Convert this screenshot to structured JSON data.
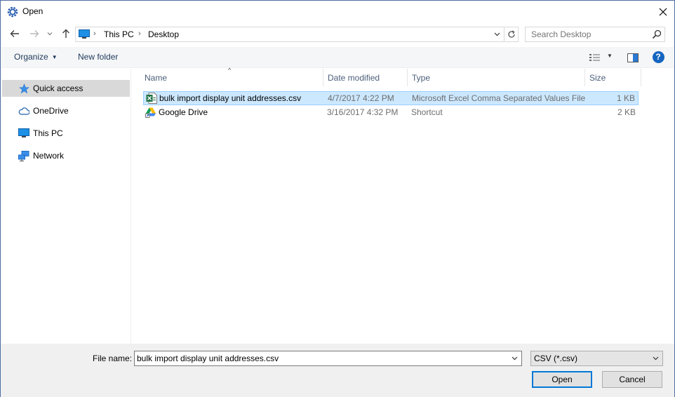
{
  "window": {
    "title": "Open",
    "icon": "app-gear-icon",
    "close_icon": "close-icon"
  },
  "nav_buttons": {
    "back_icon": "back-arrow-icon",
    "forward_icon": "forward-arrow-icon",
    "recent_icon": "chevron-down-icon",
    "up_icon": "up-arrow-icon"
  },
  "address_bar": {
    "location_icon": "this-pc-icon",
    "breadcrumbs": [
      {
        "label": "This PC"
      },
      {
        "label": "Desktop"
      }
    ],
    "separator": "›",
    "refresh_icon": "refresh-icon"
  },
  "search": {
    "placeholder": "Search Desktop",
    "icon": "search-icon"
  },
  "toolbar": {
    "organize_label": "Organize",
    "organize_arrow": "▼",
    "new_folder_label": "New folder",
    "view_icon": "details-view-icon",
    "view_arrow": "▼",
    "preview_pane_icon": "preview-pane-icon",
    "help_icon": "help-icon",
    "help_glyph": "?"
  },
  "nav_pane": {
    "items": [
      {
        "label": "Quick access",
        "icon": "star-icon",
        "selected": true
      },
      {
        "label": "OneDrive",
        "icon": "cloud-icon",
        "selected": false
      },
      {
        "label": "This PC",
        "icon": "computer-icon",
        "selected": false
      },
      {
        "label": "Network",
        "icon": "network-icon",
        "selected": false
      }
    ]
  },
  "file_list": {
    "sort_caret": "^",
    "columns": [
      {
        "label": "Name"
      },
      {
        "label": "Date modified"
      },
      {
        "label": "Type"
      },
      {
        "label": "Size"
      }
    ],
    "rows": [
      {
        "name": "bulk import display unit addresses.csv",
        "date": "4/7/2017 4:22 PM",
        "type": "Microsoft Excel Comma Separated Values File",
        "size": "1 KB",
        "icon": "excel-csv-icon",
        "selected": true
      },
      {
        "name": "Google Drive",
        "date": "3/16/2017 4:32 PM",
        "type": "Shortcut",
        "size": "2 KB",
        "icon": "google-drive-icon",
        "selected": false
      }
    ]
  },
  "footer": {
    "file_name_label": "File name:",
    "file_name_value": "bulk import display unit addresses.csv",
    "file_type_value": "CSV (*.csv)",
    "open_label": "Open",
    "cancel_label": "Cancel"
  },
  "colors": {
    "selection_bg": "#cce8ff",
    "selection_border": "#99d1ff",
    "accent": "#0078d7",
    "help_blue": "#1565c0"
  }
}
